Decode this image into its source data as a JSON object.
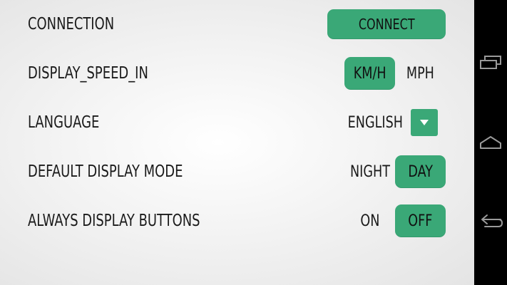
{
  "settings": {
    "connection": {
      "label": "CONNECTION",
      "button_label": "CONNECT"
    },
    "display_speed": {
      "label": "DISPLAY_SPEED_IN",
      "options": [
        "KM/H",
        "MPH"
      ],
      "selected": "KM/H"
    },
    "language": {
      "label": "LANGUAGE",
      "value": "ENGLISH",
      "dropdown_icon": "triangle-down-icon"
    },
    "display_mode": {
      "label": "DEFAULT DISPLAY MODE",
      "options": [
        "NIGHT",
        "DAY"
      ],
      "selected": "DAY"
    },
    "buttons_display": {
      "label": "ALWAYS DISPLAY BUTTONS",
      "options": [
        "ON",
        "OFF"
      ],
      "selected": "OFF"
    }
  },
  "nav_bar": {
    "buttons": [
      "recent-apps-icon",
      "home-icon",
      "back-icon"
    ]
  },
  "colors": {
    "accent": "#3aa877",
    "text": "#1a1a1a",
    "nav_background": "#000000",
    "nav_icon": "#9a9a9a"
  }
}
